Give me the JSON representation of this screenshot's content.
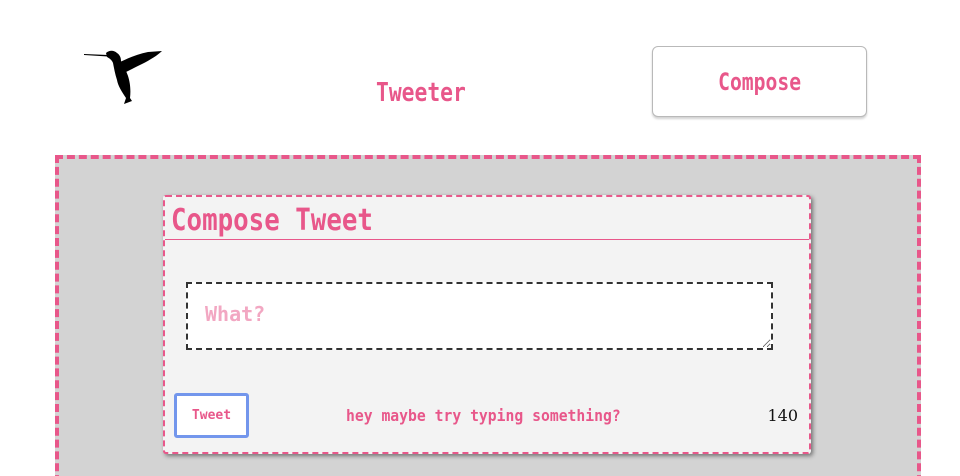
{
  "header": {
    "logo_icon": "hummingbird-icon",
    "title": "Tweeter",
    "compose_label": "Compose"
  },
  "compose_card": {
    "title": "Compose Tweet",
    "input_placeholder": "What?",
    "input_value": "",
    "tweet_button_label": "Tweet",
    "hint": "hey maybe try typing something?",
    "char_count": "140"
  },
  "colors": {
    "accent": "#e8578a",
    "placeholder": "#f2a7c2",
    "main_background": "#d3d3d3",
    "card_background": "#f3f3f3",
    "tweet_button_border": "#7396ec"
  }
}
